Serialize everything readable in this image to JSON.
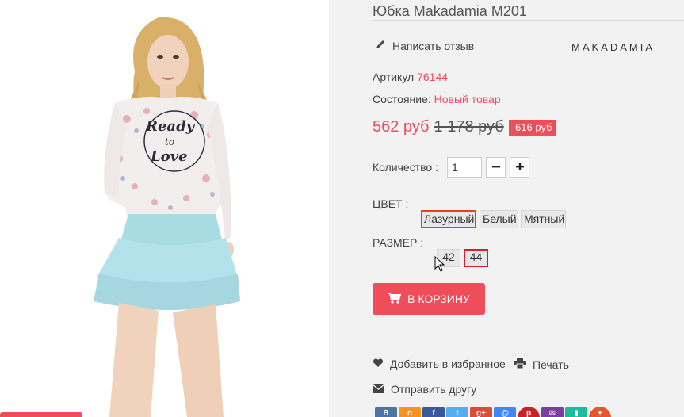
{
  "product": {
    "title": "Юбка Makadamia M201",
    "brand": "MAKADAMIA",
    "review_label": "Написать отзыв",
    "sku_label": "Артикул",
    "sku": "76144",
    "condition_label": "Состояние:",
    "condition": "Новый товар",
    "price": "562 руб",
    "old_price": "1 178 руб",
    "discount": "-616 руб"
  },
  "quantity": {
    "label": "Количество :",
    "value": "1",
    "minus": "−",
    "plus": "+"
  },
  "color": {
    "label": "ЦВЕТ :",
    "options": [
      "Лазурный",
      "Белый",
      "Мятный"
    ],
    "selected": "Лазурный"
  },
  "size": {
    "label": "РАЗМЕР :",
    "options": [
      "42",
      "44"
    ],
    "selected": "44"
  },
  "cart_button": {
    "label": "В КОРЗИНУ",
    "icon": "cart-icon"
  },
  "actions": {
    "favorite": "Добавить в избранное",
    "print": "Печать",
    "send": "Отправить другу"
  },
  "image_print": {
    "line1": "Ready",
    "line2": "to",
    "line3": "Love"
  },
  "social_colors": [
    "#4c75a3",
    "#f7931e",
    "#3b5998",
    "#55acee",
    "#dd4b39",
    "#4285f4",
    "#cb2027",
    "#7b3fa0",
    "#1abc9c",
    "#e4572e"
  ],
  "colors": {
    "accent": "#f04d5a",
    "selected_border": "#e0461e"
  }
}
